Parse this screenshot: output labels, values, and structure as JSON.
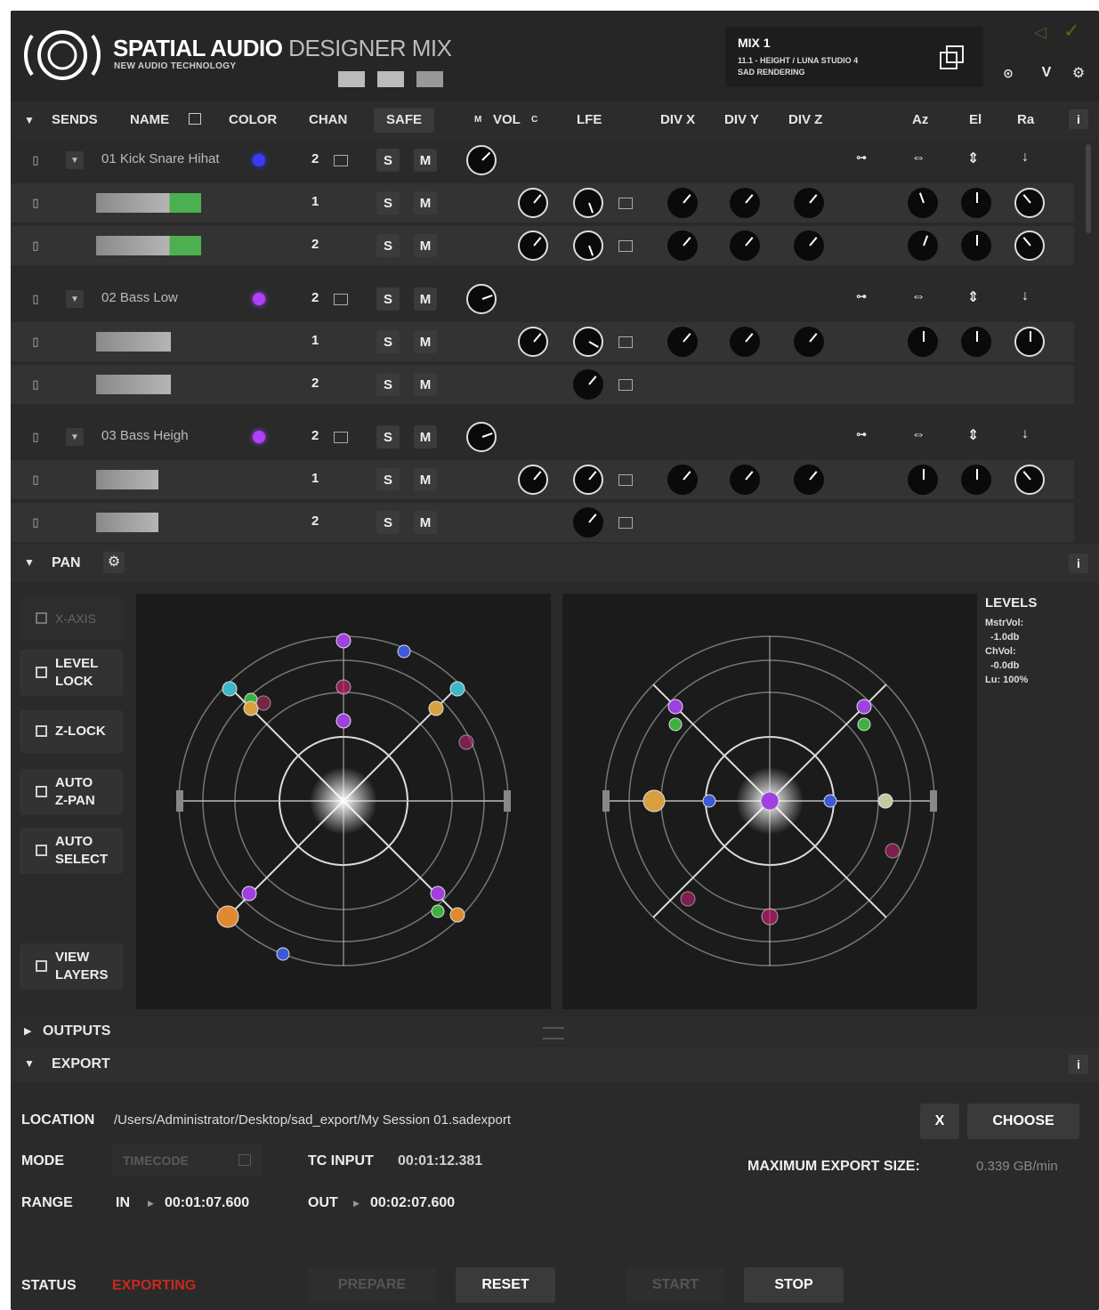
{
  "app": {
    "title_bold": "SPATIAL AUDIO",
    "title_light": "DESIGNER MIX",
    "subtitle": "NEW AUDIO TECHNOLOGY"
  },
  "mix": {
    "name": "MIX 1",
    "config": "11.1 - HEIGHT / LUNA STUDIO 4",
    "mode": "SAD RENDERING"
  },
  "header_buttons": {
    "v_label": "V"
  },
  "columns": {
    "sends": "SENDS",
    "name": "NAME",
    "color": "COLOR",
    "chan": "CHAN",
    "safe": "SAFE",
    "vol_m": "M",
    "vol": "VOL",
    "vol_c": "C",
    "lfe": "LFE",
    "divx": "DIV X",
    "divy": "DIV Y",
    "divz": "DIV Z",
    "az": "Az",
    "el": "El",
    "ra": "Ra"
  },
  "tracks": [
    {
      "name": "01 Kick Snare Hihat",
      "color": "#3a3aff",
      "chan": "2",
      "s": "S",
      "m": "M",
      "children": [
        {
          "chan": "1",
          "s": "S",
          "m": "M"
        },
        {
          "chan": "2",
          "s": "S",
          "m": "M"
        }
      ]
    },
    {
      "name": "02 Bass Low",
      "color": "#b040ff",
      "chan": "2",
      "s": "S",
      "m": "M",
      "children": [
        {
          "chan": "1",
          "s": "S",
          "m": "M"
        },
        {
          "chan": "2",
          "s": "S",
          "m": "M"
        }
      ]
    },
    {
      "name": "03 Bass Heigh",
      "color": "#b040ff",
      "chan": "2",
      "s": "S",
      "m": "M",
      "children": [
        {
          "chan": "1",
          "s": "S",
          "m": "M"
        },
        {
          "chan": "2",
          "s": "S",
          "m": "M"
        }
      ]
    }
  ],
  "pan": {
    "title": "PAN",
    "xaxis": "X-AXIS",
    "buttons": [
      {
        "l1": "LEVEL",
        "l2": "LOCK"
      },
      {
        "l1": "Z-LOCK",
        "l2": ""
      },
      {
        "l1": "AUTO",
        "l2": "Z-PAN"
      },
      {
        "l1": "AUTO",
        "l2": "SELECT"
      },
      {
        "l1": "VIEW",
        "l2": "LAYERS"
      }
    ],
    "levels": {
      "title": "LEVELS",
      "mstrvol_label": "MstrVol:",
      "mstrvol": "-1.0db",
      "chvol_label": "ChVol:",
      "chvol": "-0.0db",
      "lu": "Lu: 100%"
    }
  },
  "outputs": {
    "title": "OUTPUTS"
  },
  "export": {
    "title": "EXPORT",
    "location_label": "LOCATION",
    "location": "/Users/Administrator/Desktop/sad_export/My Session 01.sadexport",
    "clear_label": "X",
    "choose_label": "CHOOSE",
    "mode_label": "MODE",
    "mode": "TIMECODE",
    "tc_input_label": "TC INPUT",
    "tc_input": "00:01:12.381",
    "max_label": "MAXIMUM EXPORT SIZE:",
    "max_value": "0.339 GB/min",
    "range_label": "RANGE",
    "in_label": "IN",
    "in_value": "00:01:07.600",
    "out_label": "OUT",
    "out_value": "00:02:07.600",
    "status_label": "STATUS",
    "status_value": "EXPORTING",
    "status_color": "#c8281e",
    "prepare": "PREPARE",
    "reset": "RESET",
    "start": "START",
    "stop": "STOP"
  }
}
